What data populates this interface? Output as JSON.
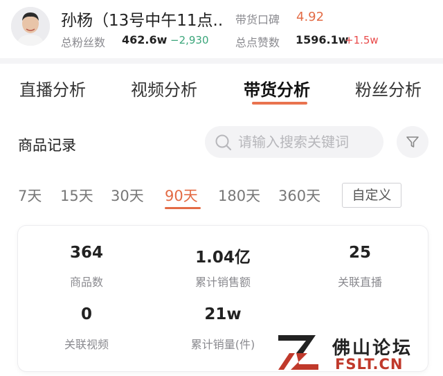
{
  "header": {
    "anchor_name": "孙杨（13号中午11点..",
    "reputation_label": "带货口碑",
    "reputation_value": "4.92",
    "fans_label": "总粉丝数",
    "fans_value": "462.6w",
    "fans_delta": "−2,930",
    "likes_label": "总点赞数",
    "likes_value": "1596.1w",
    "likes_delta": "+1.5w",
    "colors": {
      "accent": "#e36b45",
      "delta_negative": "#3aa57a",
      "delta_positive": "#e94a4a"
    }
  },
  "tabs": [
    {
      "label": "直播分析",
      "active": false
    },
    {
      "label": "视频分析",
      "active": false
    },
    {
      "label": "带货分析",
      "active": true
    },
    {
      "label": "粉丝分析",
      "active": false
    }
  ],
  "records": {
    "title": "商品记录",
    "search_placeholder": "请输入搜索关键词",
    "search_icon": "search-icon",
    "filter_icon": "filter-icon",
    "ranges": [
      {
        "label": "7天",
        "active": false
      },
      {
        "label": "15天",
        "active": false
      },
      {
        "label": "30天",
        "active": false
      },
      {
        "label": "90天",
        "active": true
      },
      {
        "label": "180天",
        "active": false
      },
      {
        "label": "360天",
        "active": false
      }
    ],
    "custom_label": "自定义"
  },
  "stats": [
    {
      "value": "364",
      "label": "商品数"
    },
    {
      "value": "1.04亿",
      "label": "累计销售额"
    },
    {
      "value": "25",
      "label": "关联直播"
    },
    {
      "value": "0",
      "label": "关联视频"
    },
    {
      "value": "21w",
      "label": "累计销量(件)"
    }
  ],
  "watermark": {
    "cn": "佛山论坛",
    "en": "FSLT.CN"
  }
}
